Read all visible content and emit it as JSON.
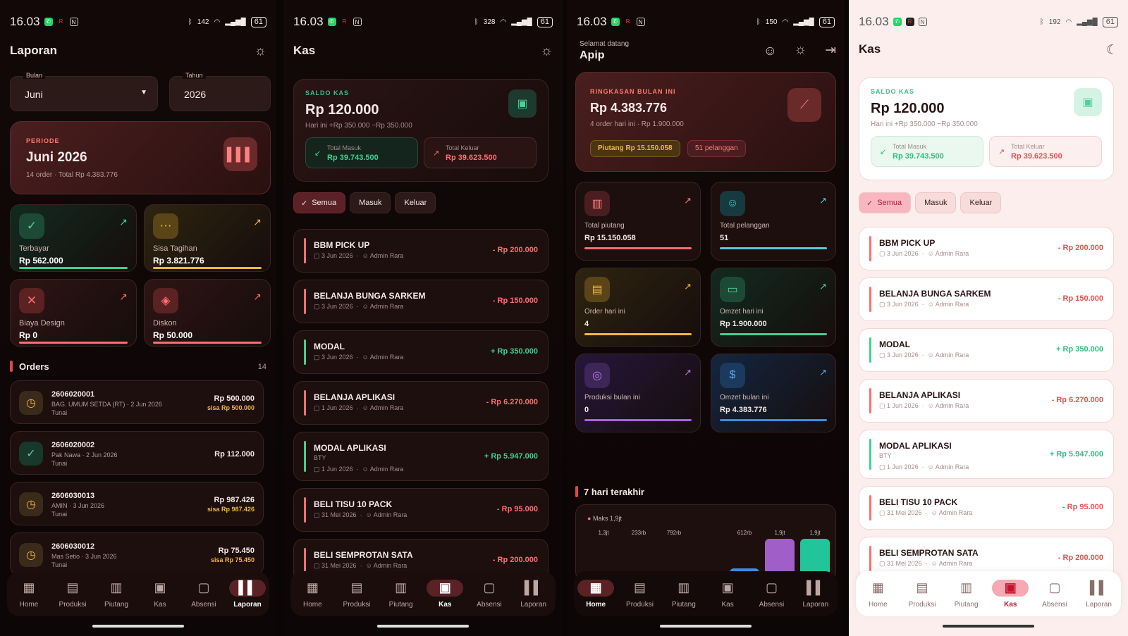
{
  "status": {
    "time": "16.03",
    "battery": "61",
    "net": [
      "142",
      "328",
      "150",
      "192"
    ],
    "net_unit": "B/s"
  },
  "p1": {
    "title": "Laporan",
    "bulan_label": "Bulan",
    "bulan_value": "Juni",
    "tahun_label": "Tahun",
    "tahun_value": "2026",
    "periode_label": "PERIODE",
    "periode_value": "Juni 2026",
    "periode_sub": "14 order  ·  Total Rp 4.383.776",
    "stats": [
      {
        "label": "Terbayar",
        "value": "Rp 562.000"
      },
      {
        "label": "Sisa Tagihan",
        "value": "Rp 3.821.776"
      },
      {
        "label": "Biaya Design",
        "value": "Rp 0"
      },
      {
        "label": "Diskon",
        "value": "Rp 50.000"
      }
    ],
    "orders_title": "Orders",
    "orders_count": "14",
    "orders": [
      {
        "id": "2606020001",
        "sub": "BAG. UMUM SETDA (RT)  ·  2 Jun 2026",
        "pay": "Tunai",
        "amount": "Rp 500.000",
        "sisa": "sisa Rp 500.000"
      },
      {
        "id": "2606020002",
        "sub": "Pak Nawa  ·  2 Jun 2026",
        "pay": "Tunai",
        "amount": "Rp 112.000",
        "sisa": ""
      },
      {
        "id": "2606030013",
        "sub": "AMIN  ·  3 Jun 2026",
        "pay": "Tunai",
        "amount": "Rp 987.426",
        "sisa": "sisa Rp 987.426"
      },
      {
        "id": "2606030012",
        "sub": "Mas Setio  ·  3 Jun 2026",
        "pay": "Tunai",
        "amount": "Rp 75.450",
        "sisa": "sisa Rp 75.450"
      }
    ]
  },
  "kas": {
    "title": "Kas",
    "saldo_label": "SALDO KAS",
    "saldo_value": "Rp 120.000",
    "saldo_sub": "Hari ini  +Rp 350.000  −Rp 350.000",
    "masuk_label": "Total Masuk",
    "masuk_value": "Rp 39.743.500",
    "keluar_label": "Total Keluar",
    "keluar_value": "Rp 39.623.500",
    "filters": [
      "Semua",
      "Masuk",
      "Keluar"
    ],
    "tx": [
      {
        "name": "BBM PICK UP",
        "sub": "",
        "date": "3 Jun 2026",
        "by": "Admin Rara",
        "amount": "- Rp 200.000",
        "type": "neg"
      },
      {
        "name": "BELANJA BUNGA SARKEM",
        "sub": "",
        "date": "3 Jun 2026",
        "by": "Admin Rara",
        "amount": "- Rp 150.000",
        "type": "neg"
      },
      {
        "name": "MODAL",
        "sub": "",
        "date": "3 Jun 2026",
        "by": "Admin Rara",
        "amount": "+ Rp 350.000",
        "type": "pos"
      },
      {
        "name": "BELANJA APLIKASI",
        "sub": "",
        "date": "1 Jun 2026",
        "by": "Admin Rara",
        "amount": "- Rp 6.270.000",
        "type": "neg"
      },
      {
        "name": "MODAL APLIKASI",
        "sub": "BTY",
        "date": "1 Jun 2026",
        "by": "Admin Rara",
        "amount": "+ Rp 5.947.000",
        "type": "pos"
      },
      {
        "name": "BELI TISU 10 PACK",
        "sub": "",
        "date": "31 Mei 2026",
        "by": "Admin Rara",
        "amount": "- Rp 95.000",
        "type": "neg"
      },
      {
        "name": "BELI SEMPROTAN SATA",
        "sub": "",
        "date": "31 Mei 2026",
        "by": "Admin Rara",
        "amount": "- Rp 200.000",
        "type": "neg"
      }
    ]
  },
  "p3": {
    "greet": "Selamat datang",
    "user": "Apip",
    "ring_label": "RINGKASAN BULAN INI",
    "ring_value": "Rp 4.383.776",
    "ring_sub": "4 order hari ini  ·  Rp 1.900.000",
    "pill1": "Piutang Rp 15.150.058",
    "pill2": "51 pelanggan",
    "minis": [
      {
        "label": "Total piutang",
        "value": "Rp 15.150.058"
      },
      {
        "label": "Total pelanggan",
        "value": "51"
      },
      {
        "label": "Order hari ini",
        "value": "4"
      },
      {
        "label": "Omzet hari ini",
        "value": "Rp 1.900.000"
      },
      {
        "label": "Produksi bulan ini",
        "value": "0"
      },
      {
        "label": "Omzet bulan ini",
        "value": "Rp 4.383.776"
      }
    ],
    "week_title": "7 hari terakhir",
    "max_label": "Maks 1,9jt"
  },
  "chart_data": {
    "type": "bar",
    "title": "7 hari terakhir",
    "data_labels": [
      "1,3jt",
      "233rb",
      "792rb",
      "",
      "612rb",
      "1,9jt",
      "1,9jt"
    ],
    "values": [
      1.3,
      0.233,
      0.792,
      0,
      0.612,
      1.9,
      1.9
    ],
    "unit": "jt",
    "colors": [
      "#3b8de0",
      "#3b8de0",
      "#3b8de0",
      "#3b8de0",
      "#3b8de0",
      "#a05fc8",
      "#22c59a"
    ]
  },
  "nav": [
    "Home",
    "Produksi",
    "Piutang",
    "Kas",
    "Absensi",
    "Laporan"
  ]
}
